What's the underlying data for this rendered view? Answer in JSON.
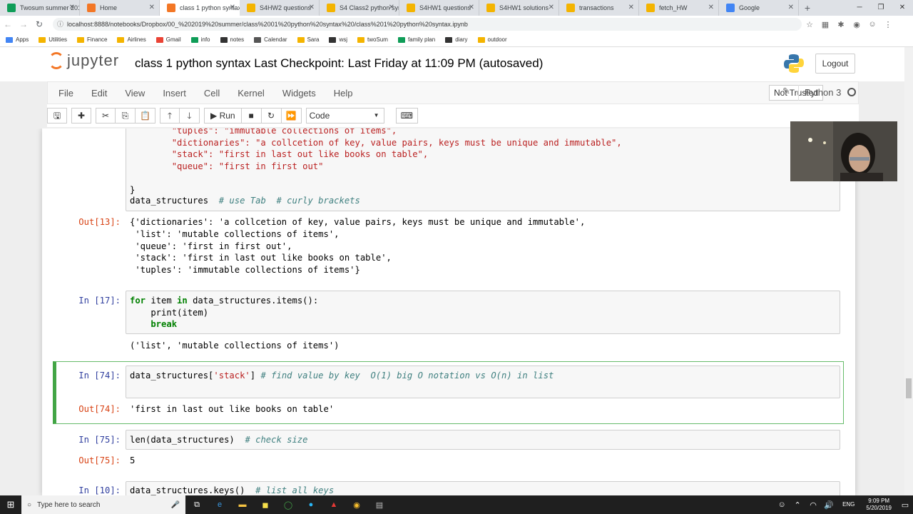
{
  "browser": {
    "tabs": [
      {
        "label": "Twosum summer 2019",
        "color": "#0f9d58"
      },
      {
        "label": "Home",
        "color": "#f37726"
      },
      {
        "label": "class 1 python syntax",
        "color": "#f37726",
        "active": true
      },
      {
        "label": "S4HW2 questions",
        "color": "#f4b400"
      },
      {
        "label": "S4 Class2 python syn",
        "color": "#f4b400"
      },
      {
        "label": "S4HW1 questions",
        "color": "#f4b400"
      },
      {
        "label": "S4HW1 solutions",
        "color": "#f4b400"
      },
      {
        "label": "transactions",
        "color": "#f4b400"
      },
      {
        "label": "fetch_HW",
        "color": "#f4b400"
      },
      {
        "label": "Google",
        "color": "#4285f4"
      }
    ],
    "new_tab": "+",
    "url": "localhost:8888/notebooks/Dropbox/00_%202019%20summer/class%2001%20python%20syntax%20/class%201%20python%20syntax.ipynb",
    "bookmarks": [
      "Apps",
      "Utilities",
      "Finance",
      "Airlines",
      "Gmail",
      "info",
      "notes",
      "Calendar",
      "Sara",
      "wsj",
      "twoSum",
      "family plan",
      "diary",
      "outdoor"
    ]
  },
  "jupyter": {
    "logo_text": "jupyter",
    "title": "class 1 python syntax",
    "checkpoint": "Last Checkpoint: Last Friday at 11:09 PM",
    "autosaved": "(autosaved)",
    "logout": "Logout",
    "menu": [
      "File",
      "Edit",
      "View",
      "Insert",
      "Cell",
      "Kernel",
      "Widgets",
      "Help"
    ],
    "trust": "Not Trusted",
    "kernel": "Python 3",
    "run_label": "Run",
    "cell_type": "Code"
  },
  "cells": {
    "c13_lines": [
      "        \"tuples\": \"immutable collections of items\",",
      "        \"dictionaries\": \"a collcetion of key, value pairs, keys must be unique and immutable\",",
      "        \"stack\": \"first in last out like books on table\",",
      "        \"queue\": \"first in first out\"",
      "",
      "}"
    ],
    "c13_last_code": "data_structures",
    "c13_last_comment": "# use Tab  # curly brackets",
    "out13_prompt": "Out[13]:",
    "out13_lines": [
      "{'dictionaries': 'a collcetion of key, value pairs, keys must be unique and immutable',",
      " 'list': 'mutable collections of items',",
      " 'queue': 'first in first out',",
      " 'stack': 'first in last out like books on table',",
      " 'tuples': 'immutable collections of items'}"
    ],
    "in17_prompt": "In [17]:",
    "in17_line1_kw1": "for",
    "in17_line1_mid": " item ",
    "in17_line1_kw2": "in",
    "in17_line1_rest": " data_structures.items():",
    "in17_line2": "    print(item)",
    "in17_line3": "    break",
    "out17": "('list', 'mutable collections of items')",
    "in74_prompt": "In [74]:",
    "in74_code": "data_structures[",
    "in74_str": "'stack'",
    "in74_close": "] ",
    "in74_comment": "# find value by key  O(1) big O notation vs O(n) in list",
    "out74_prompt": "Out[74]:",
    "out74": "'first in last out like books on table'",
    "in75_prompt": "In [75]:",
    "in75_code": "len(data_structures)  ",
    "in75_comment": "# check size",
    "out75_prompt": "Out[75]:",
    "out75": "5",
    "in10_prompt": "In [10]:",
    "in10_code": "data_structures.keys()  ",
    "in10_comment": "# list all keys"
  },
  "taskbar": {
    "search_placeholder": "Type here to search",
    "lang": "ENG",
    "time": "9:09 PM",
    "date": "5/20/2019"
  }
}
